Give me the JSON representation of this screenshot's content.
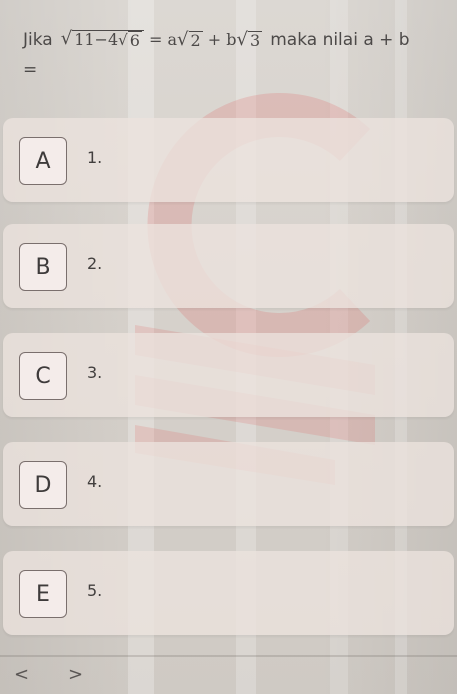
{
  "question": {
    "prefix": "Jika",
    "radical_outer": "11−4",
    "radical_inner": "6",
    "equals": "=",
    "a": "a",
    "r2": "2",
    "plus": "+",
    "b": "b",
    "r3": "3",
    "suffix": "maka nilai a + b",
    "line2": "="
  },
  "options": [
    {
      "letter": "A",
      "text": "1."
    },
    {
      "letter": "B",
      "text": "2."
    },
    {
      "letter": "C",
      "text": "3."
    },
    {
      "letter": "D",
      "text": "4."
    },
    {
      "letter": "E",
      "text": "5."
    }
  ],
  "nav": {
    "prev": "<",
    "next": ">"
  },
  "colors": {
    "card": "#ece3de",
    "watermark": "#e23a3a",
    "badge_border": "#7a6f6d"
  }
}
